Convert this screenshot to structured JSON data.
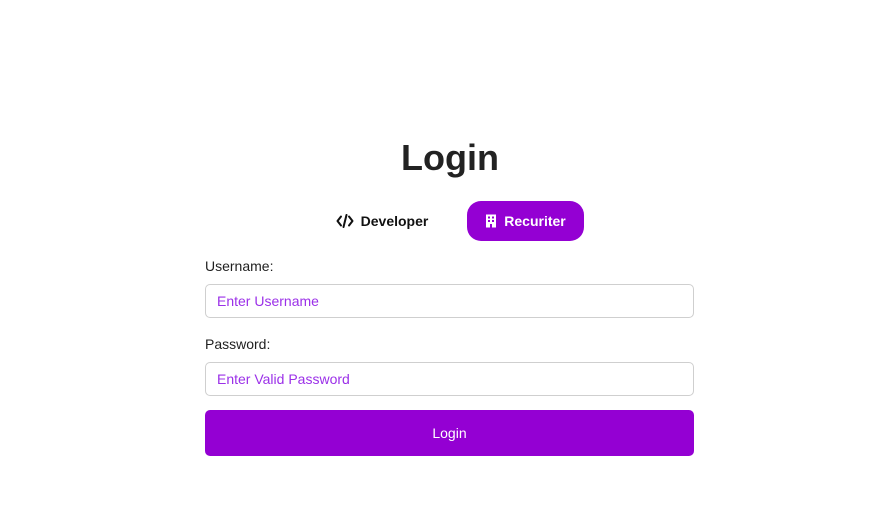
{
  "page": {
    "title": "Login"
  },
  "role_toggle": {
    "developer": {
      "label": "Developer",
      "icon": "code-icon"
    },
    "recruiter": {
      "label": "Recuriter",
      "icon": "building-icon",
      "selected": true
    }
  },
  "form": {
    "username_label": "Username:",
    "username_placeholder": "Enter Username",
    "username_value": "",
    "password_label": "Password:",
    "password_placeholder": "Enter Valid Password",
    "password_value": "",
    "submit_label": "Login"
  },
  "colors": {
    "accent": "#9400d3",
    "placeholder": "#9b30e8",
    "border": "#cfcfcf"
  }
}
